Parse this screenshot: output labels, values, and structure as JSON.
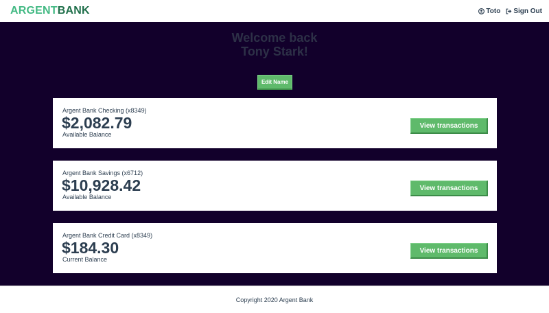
{
  "header": {
    "logo_part1": "ARGENT",
    "logo_part2": "BANK",
    "user_name": "Toto",
    "user_icon": "user-circle-icon",
    "signout_label": "Sign Out",
    "signout_icon": "sign-out-icon"
  },
  "welcome": {
    "line1": "Welcome back",
    "line2": "Tony Stark!"
  },
  "edit_name_label": "Edit Name",
  "accounts": [
    {
      "title": "Argent Bank Checking (x8349)",
      "amount": "$2,082.79",
      "description": "Available Balance",
      "button_label": "View transactions"
    },
    {
      "title": "Argent Bank Savings (x6712)",
      "amount": "$10,928.42",
      "description": "Available Balance",
      "button_label": "View transactions"
    },
    {
      "title": "Argent Bank Credit Card (x8349)",
      "amount": "$184.30",
      "description": "Current Balance",
      "button_label": "View transactions"
    }
  ],
  "footer": {
    "copyright": "Copyright 2020 Argent Bank"
  },
  "colors": {
    "brand_green": "#42b983",
    "brand_dark_green": "#1f6f4a",
    "button_green": "#5fba6b",
    "main_background": "#12002b",
    "text_dark": "#2c3e50",
    "welcome_text": "#2d3047"
  }
}
